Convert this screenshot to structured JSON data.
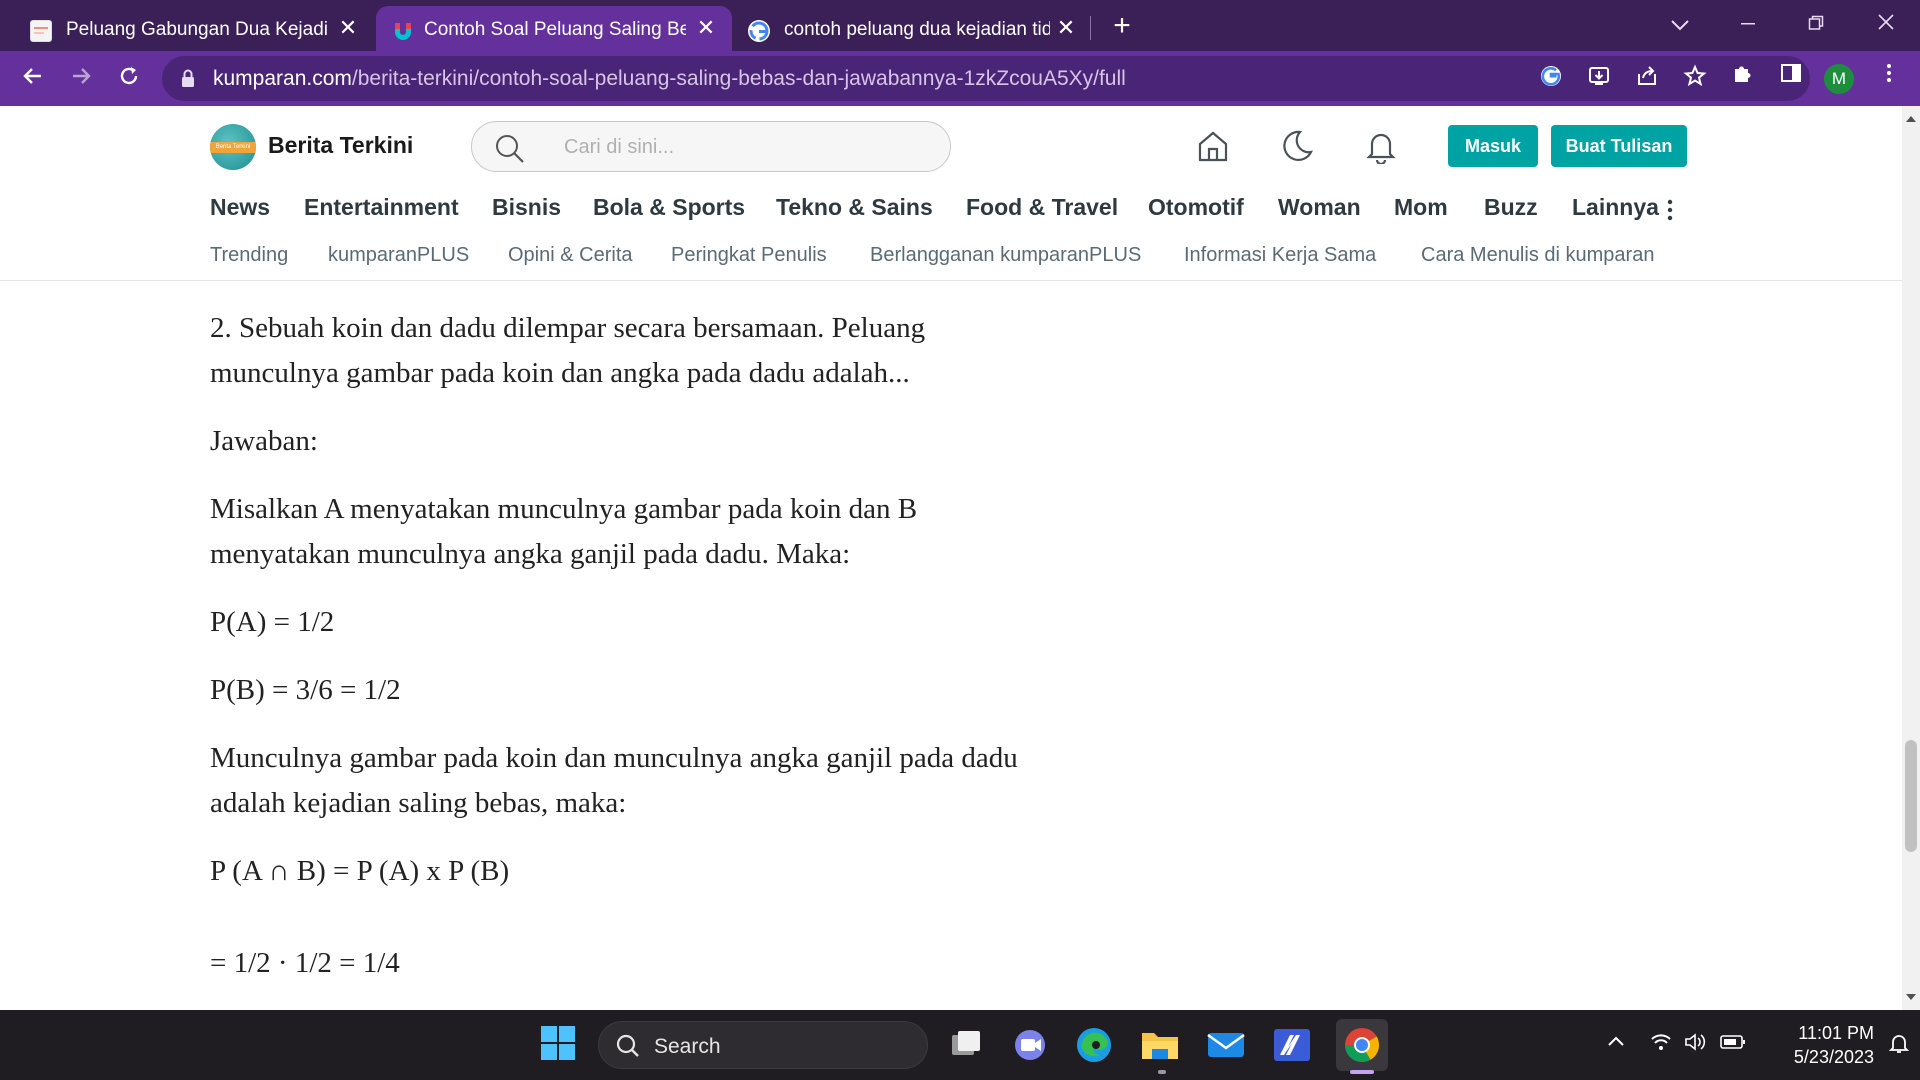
{
  "browser": {
    "tabs": [
      {
        "title": "Peluang Gabungan Dua Kejadian",
        "favicon": "page-favicon-icon",
        "active": false
      },
      {
        "title": "Contoh Soal Peluang Saling Beba",
        "favicon": "kumparan-favicon-icon",
        "active": true
      },
      {
        "title": "contoh peluang dua kejadian tida",
        "favicon": "google-favicon-icon",
        "active": false
      }
    ],
    "url": {
      "domain": "kumparan.com",
      "path": "/berita-terkini/contoh-soal-peluang-saling-bebas-dan-jawabannya-1zkZcouA5Xy/full"
    },
    "profile_initial": "M",
    "theme_color": "#64309b",
    "tabstrip_color": "#3b1f57"
  },
  "site": {
    "brand": "Berita Terkini",
    "logo_text": "Berita Terkini",
    "search_placeholder": "Cari di sini...",
    "login_label": "Masuk",
    "write_label": "Buat Tulisan",
    "accent": "#00a3a3",
    "categories": [
      "News",
      "Entertainment",
      "Bisnis",
      "Bola & Sports",
      "Tekno & Sains",
      "Food & Travel",
      "Otomotif",
      "Woman",
      "Mom",
      "Buzz",
      "Lainnya"
    ],
    "subnav": [
      "Trending",
      "kumparanPLUS",
      "Opini & Cerita",
      "Peringkat Penulis",
      "Berlangganan kumparanPLUS",
      "Informasi Kerja Sama",
      "Cara Menulis di kumparan"
    ]
  },
  "article": {
    "lines": [
      "2. Sebuah koin dan dadu dilempar secara bersamaan. Peluang",
      "munculnya gambar pada koin dan angka pada dadu adalah...",
      "Jawaban:",
      "Misalkan A menyatakan  munculnya gambar pada koin dan B",
      "menyatakan munculnya angka ganjil pada dadu. Maka:",
      "P(A) = 1/2",
      "P(B) = 3/6 = 1/2",
      "Munculnya gambar pada koin dan munculnya angka ganjil pada dadu",
      "adalah kejadian saling bebas, maka:",
      "P (A ∩ B) = P (A) x P (B)",
      "= 1/2 · 1/2 = 1/4"
    ]
  },
  "taskbar": {
    "search_label": "Search",
    "time": "11:01 PM",
    "date": "5/23/2023"
  }
}
